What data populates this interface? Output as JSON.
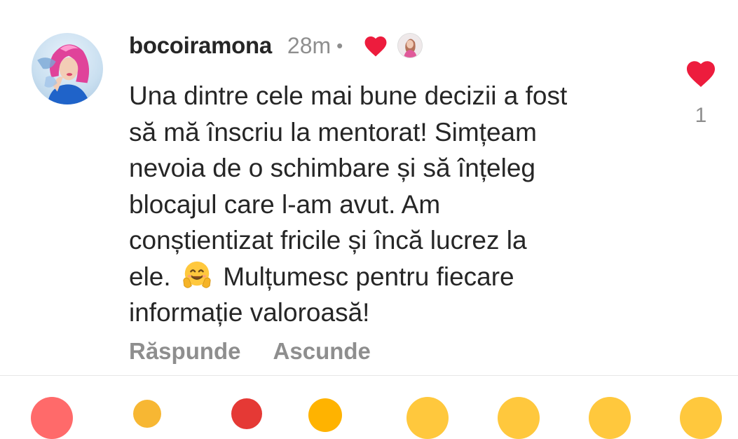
{
  "comment": {
    "username": "bocoiramona",
    "time": "28m",
    "separator": "•",
    "text_lines": [
      "Una dintre cele mai bune decizii a fost",
      "să mă înscriu la mentorat! Simțeam",
      "nevoia de o schimbare și să înțeleg",
      "blocajul care l-am avut. Am",
      "conștientizat fricile și încă lucrez la"
    ],
    "line6_before": "ele.",
    "line6_emoji": "hugging-face-emoji",
    "line6_after": "Mulțumesc pentru fiecare",
    "line7": "informație valoroasă!",
    "reply_label": "Răspunde",
    "hide_label": "Ascunde",
    "like_count": "1"
  },
  "colors": {
    "heart": "#ed1c3d",
    "text": "#262626",
    "muted": "#8e8e8e"
  },
  "icons": {
    "author_liked": "heart-icon",
    "like": "heart-icon"
  }
}
